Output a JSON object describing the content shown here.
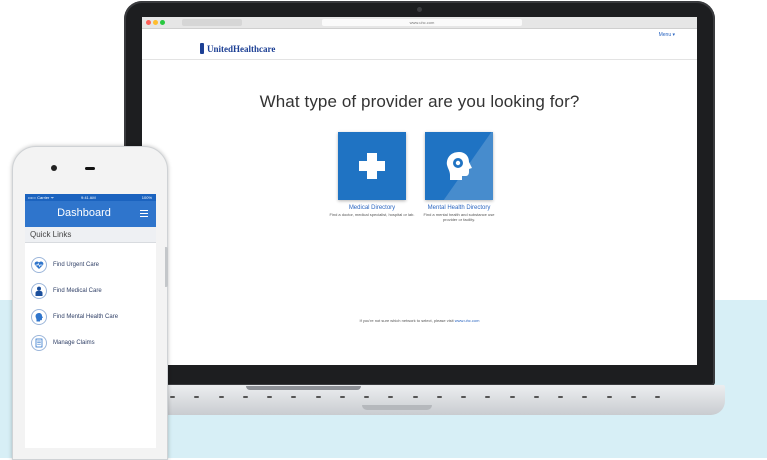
{
  "browser": {
    "address": "www.uhc.com"
  },
  "site": {
    "menu_label": "Menu  ▾",
    "logo_text": "UnitedHealthcare",
    "headline": "What type of provider are you looking for?",
    "options": [
      {
        "title": "Medical Directory",
        "description": "Find a doctor, medical specialist, hospital or lab.",
        "icon": "medical-cross-icon"
      },
      {
        "title": "Mental Health Directory",
        "description": "Find a mental health and substance use provider or facility.",
        "icon": "head-brain-icon"
      }
    ],
    "footnote_prefix": "If you're not sure which network to select, please visit ",
    "footnote_link": "www.uhc.com"
  },
  "phone": {
    "status": {
      "carrier": "••••○ Carrier ᯤ",
      "time": "9:41 AM",
      "battery": "100%"
    },
    "app_title": "Dashboard",
    "quick_links_heading": "Quick Links",
    "quick_links": [
      {
        "label": "Find Urgent Care",
        "icon": "heart-pulse-icon"
      },
      {
        "label": "Find Medical Care",
        "icon": "doctor-icon"
      },
      {
        "label": "Find Mental Health Care",
        "icon": "head-icon"
      },
      {
        "label": "Manage Claims",
        "icon": "document-icon"
      }
    ]
  },
  "colors": {
    "brand_blue": "#1f73c3",
    "background_band": "#d7eff6"
  }
}
